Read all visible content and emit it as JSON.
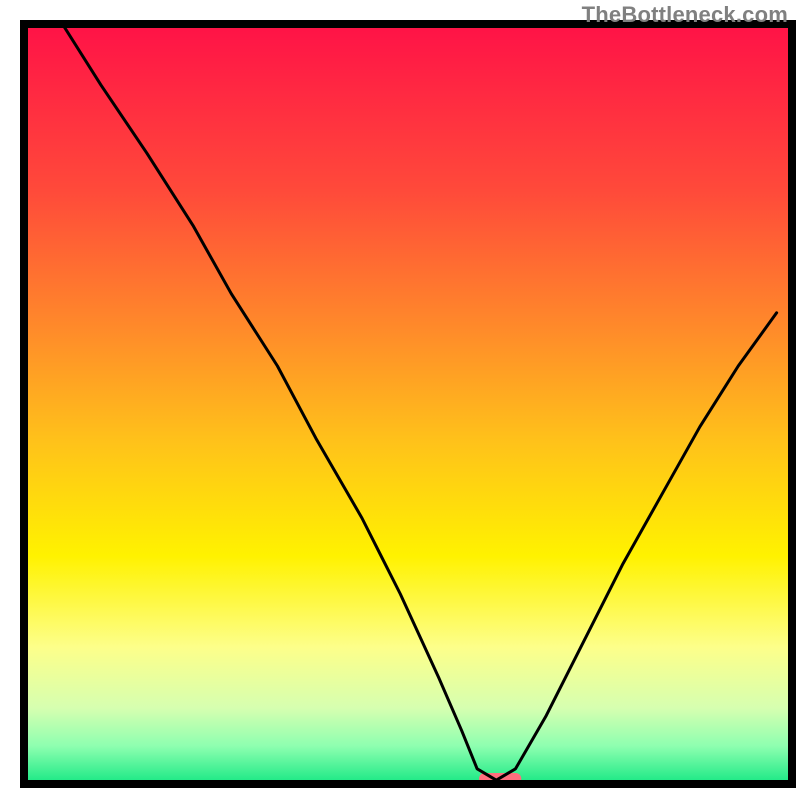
{
  "watermark": "TheBottleneck.com",
  "chart_data": {
    "type": "line",
    "title": "",
    "xlabel": "",
    "ylabel": "",
    "xlim": [
      0,
      100
    ],
    "ylim": [
      0,
      100
    ],
    "grid": false,
    "legend": false,
    "annotations": [],
    "frame": {
      "left_x": 3,
      "right_x": 99,
      "top_y": 3,
      "bottom_y": 98
    },
    "gradient_stops": [
      {
        "offset": 0.0,
        "color": "#ff1247"
      },
      {
        "offset": 0.22,
        "color": "#ff4a3a"
      },
      {
        "offset": 0.4,
        "color": "#ff8a2a"
      },
      {
        "offset": 0.55,
        "color": "#ffc21a"
      },
      {
        "offset": 0.7,
        "color": "#fff200"
      },
      {
        "offset": 0.82,
        "color": "#fdff8a"
      },
      {
        "offset": 0.9,
        "color": "#d6ffb0"
      },
      {
        "offset": 0.95,
        "color": "#8effb0"
      },
      {
        "offset": 1.0,
        "color": "#17e884"
      }
    ],
    "series": [
      {
        "name": "bottleneck-curve",
        "x": [
          5,
          10,
          16,
          22,
          27,
          33,
          38,
          44,
          49,
          54,
          57,
          59,
          61.5,
          64,
          68,
          73,
          78,
          83,
          88,
          93,
          98
        ],
        "values": [
          100,
          92,
          83,
          73.5,
          64.5,
          55,
          45.5,
          35,
          25,
          14,
          7,
          2,
          0.5,
          2,
          9,
          19,
          29,
          38,
          47,
          55,
          62
        ]
      }
    ],
    "marker": {
      "name": "optimal-pill",
      "cx": 62,
      "cy": 0.7,
      "width": 5.5,
      "height": 1.5,
      "color": "#ff6e7d"
    }
  }
}
